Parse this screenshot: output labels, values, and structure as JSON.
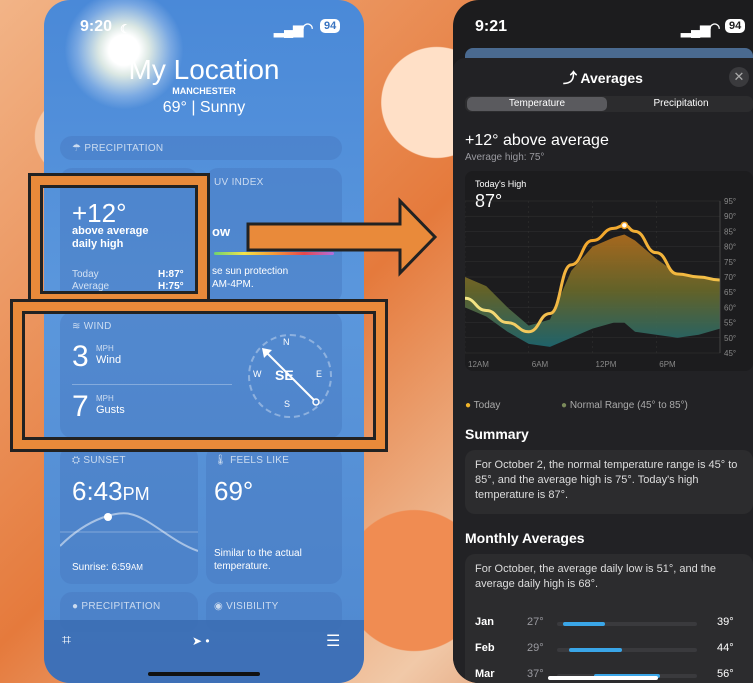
{
  "left": {
    "time": "9:20",
    "signal": "ııl",
    "battery": "94",
    "location": "My Location",
    "city": "MANCHESTER",
    "condition": "69° | Sunny",
    "precip_header": "PRECIPITATION",
    "averages": {
      "value": "+12°",
      "desc1": "above average",
      "desc2": "daily high",
      "today_label": "Today",
      "today_value": "H:87°",
      "avg_label": "Average",
      "avg_value": "H:75°"
    },
    "uv": {
      "header": "UV INDEX",
      "level": "ow",
      "text1": "se sun protection",
      "text2": "AM-4PM."
    },
    "wind": {
      "header": "WIND",
      "speed": "3",
      "speed_unit": "MPH",
      "speed_label": "Wind",
      "gust": "7",
      "gust_unit": "MPH",
      "gust_label": "Gusts",
      "direction": "SE",
      "n": "N",
      "s": "S",
      "e": "E",
      "w": "W"
    },
    "sunset": {
      "header": "SUNSET",
      "time": "6:43",
      "ampm": "PM",
      "sunrise": "Sunrise: 6:59",
      "sunrise_ampm": "AM"
    },
    "feels": {
      "header": "FEELS LIKE",
      "value": "69°",
      "text1": "Similar to the actual",
      "text2": "temperature."
    },
    "bottom": {
      "precip": "PRECIPITATION",
      "visibility": "VISIBILITY"
    }
  },
  "right": {
    "time": "9:21",
    "battery": "94",
    "title": "Averages",
    "tabs": [
      "Temperature",
      "Precipitation"
    ],
    "headline": "+12° above average",
    "subhead": "Average high: 75°",
    "chart_title": "Today's High",
    "chart_value": "87°",
    "legend_today": "Today",
    "legend_normal": "Normal Range (45° to 85°)",
    "summary_title": "Summary",
    "summary_text": "For October 2, the normal temperature range is 45° to 85°, and the average high is 75°. Today's high temperature is 87°.",
    "monthly_title": "Monthly Averages",
    "monthly_text": "For October, the average daily low is 51°, and the average daily high is 68°.",
    "months": [
      {
        "name": "Jan",
        "low": "27°",
        "high": "39°",
        "low_n": 27,
        "high_n": 39
      },
      {
        "name": "Feb",
        "low": "29°",
        "high": "44°",
        "low_n": 29,
        "high_n": 44
      },
      {
        "name": "Mar",
        "low": "37°",
        "high": "56°",
        "low_n": 37,
        "high_n": 56
      }
    ]
  },
  "chart_data": {
    "type": "area",
    "x_labels": [
      "12AM",
      "6AM",
      "12PM",
      "6PM"
    ],
    "y_labels": [
      "95°",
      "90°",
      "85°",
      "80°",
      "75°",
      "70°",
      "65°",
      "60°",
      "55°",
      "50°",
      "45°"
    ],
    "ylim": [
      45,
      95
    ],
    "hours": [
      0,
      2,
      4,
      6,
      8,
      10,
      12,
      14,
      15,
      16,
      18,
      20,
      22,
      24
    ],
    "today": [
      63,
      59,
      55,
      52,
      58,
      74,
      82,
      86,
      87,
      85,
      78,
      71,
      70,
      69
    ],
    "normal_low": [
      60,
      57,
      52,
      48,
      47,
      50,
      53,
      55,
      55,
      52,
      51,
      50,
      51,
      53
    ],
    "normal_high": [
      70,
      67,
      60,
      54,
      56,
      72,
      80,
      83,
      84,
      82,
      76,
      71,
      70,
      69
    ]
  }
}
